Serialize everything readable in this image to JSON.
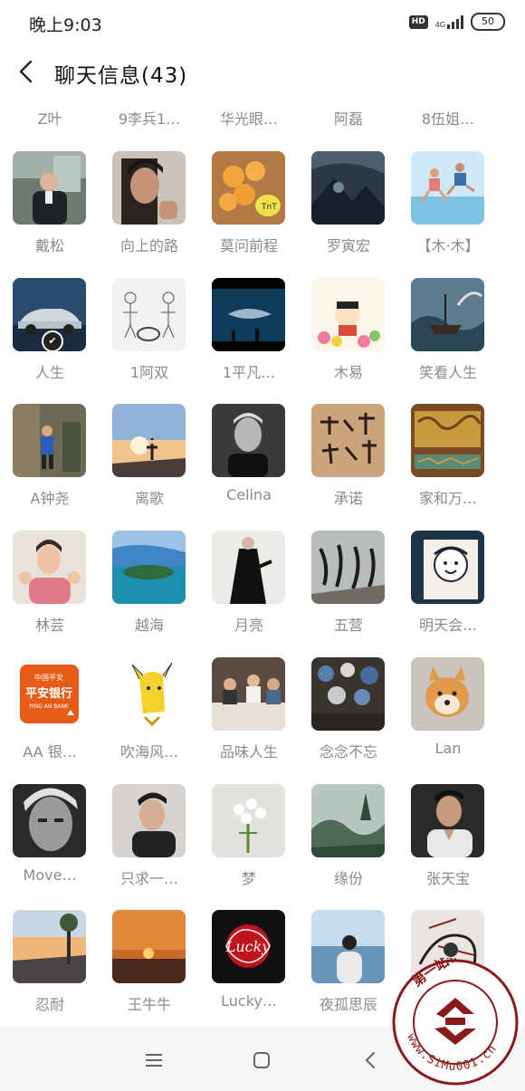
{
  "status_bar": {
    "time": "晚上9:03",
    "hd": "HD",
    "network": "4G",
    "battery": "50"
  },
  "header": {
    "title": "聊天信息(43)"
  },
  "partial_row": [
    "Z叶",
    "9李兵1…",
    "华光眼…",
    "阿磊",
    "8伍姐…"
  ],
  "members": [
    {
      "name": "戴松",
      "avatar": "suit-man-photo"
    },
    {
      "name": "向上的路",
      "avatar": "man-portrait-photo"
    },
    {
      "name": "莫问前程",
      "avatar": "eggs-basket-photo"
    },
    {
      "name": "罗寅宏",
      "avatar": "dark-landscape-photo"
    },
    {
      "name": "【木·木】",
      "avatar": "jumping-kids-photo"
    },
    {
      "name": "人生",
      "avatar": "sports-car-photo"
    },
    {
      "name": "1阿双",
      "avatar": "sketch-figures-drawing"
    },
    {
      "name": "1平凡…",
      "avatar": "aquarium-shark-photo"
    },
    {
      "name": "木易",
      "avatar": "cartoon-boy-flowers"
    },
    {
      "name": "笑看人生",
      "avatar": "fishing-boat-painting"
    },
    {
      "name": "A钟尧",
      "avatar": "child-outdoors-photo"
    },
    {
      "name": "离歌",
      "avatar": "sunset-silhouette-photo"
    },
    {
      "name": "Celina",
      "avatar": "bw-man-portrait"
    },
    {
      "name": "承诺",
      "avatar": "calligraphy-wood"
    },
    {
      "name": "家和万…",
      "avatar": "carved-gold-wood"
    },
    {
      "name": "林芸",
      "avatar": "woman-heart-hands"
    },
    {
      "name": "越海",
      "avatar": "island-sea-photo"
    },
    {
      "name": "月亮",
      "avatar": "black-dress-woman"
    },
    {
      "name": "五营",
      "avatar": "dancers-mural"
    },
    {
      "name": "明天会…",
      "avatar": "cartoon-face-logo"
    },
    {
      "name": "AA 银…",
      "avatar": "ping-an-bank-logo"
    },
    {
      "name": "吹海风…",
      "avatar": "pikachu-drawing"
    },
    {
      "name": "品味人生",
      "avatar": "dining-people-photo"
    },
    {
      "name": "念念不忘",
      "avatar": "plates-wall-photo"
    },
    {
      "name": "Lan",
      "avatar": "shiba-dog-photo"
    },
    {
      "name": "Move…",
      "avatar": "bw-face-closeup"
    },
    {
      "name": "只求一…",
      "avatar": "man-profile-photo"
    },
    {
      "name": "梦",
      "avatar": "white-flowers-photo"
    },
    {
      "name": "缘份",
      "avatar": "misty-forest-photo"
    },
    {
      "name": "张天宝",
      "avatar": "man-suit-dark"
    },
    {
      "name": "忍耐",
      "avatar": "street-sunset-photo"
    },
    {
      "name": "王牛牛",
      "avatar": "orange-sunset-photo"
    },
    {
      "name": "Lucky…",
      "avatar": "lucky-logo"
    },
    {
      "name": "夜孤思辰",
      "avatar": "man-back-sea"
    },
    {
      "name": "一汪春",
      "avatar": "artistic-sketch"
    }
  ],
  "ping_an": {
    "title": "平安银行",
    "sub": "PING AN BANK",
    "top": "中国平安"
  },
  "lucky_text": "Lucky",
  "badge_icon": "verified-badge-icon",
  "watermark": {
    "text": "www.SiMu001.cn",
    "brand": "第一站长"
  },
  "colors": {
    "accent": "#ffffff",
    "text_dim": "#8a8a8a",
    "nav_bg": "#f6f6f6"
  }
}
